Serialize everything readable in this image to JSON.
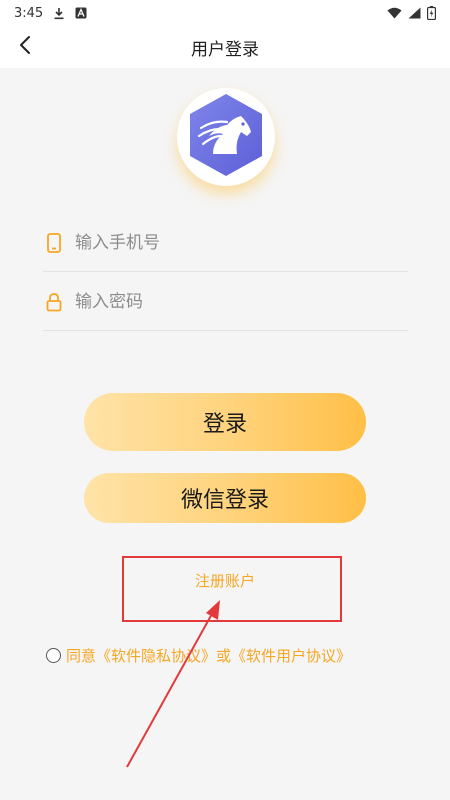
{
  "status_bar": {
    "time": "3:45"
  },
  "header": {
    "title": "用户登录"
  },
  "form": {
    "phone_placeholder": "输入手机号",
    "password_placeholder": "输入密码"
  },
  "buttons": {
    "login": "登录",
    "wechat_login": "微信登录"
  },
  "register": {
    "label": "注册账户"
  },
  "agreement": {
    "prefix": "同意",
    "privacy": "《软件隐私协议》",
    "or": "或",
    "user": "《软件用户协议》"
  },
  "colors": {
    "accent": "#f5a623",
    "button_start": "#ffe3a8",
    "button_end": "#ffbf46",
    "highlight": "#e23a3a",
    "logo": "#6f73e0"
  },
  "icons": {
    "back": "back-arrow-icon",
    "phone": "phone-icon",
    "lock": "lock-icon",
    "logo": "horse-logo-icon"
  }
}
